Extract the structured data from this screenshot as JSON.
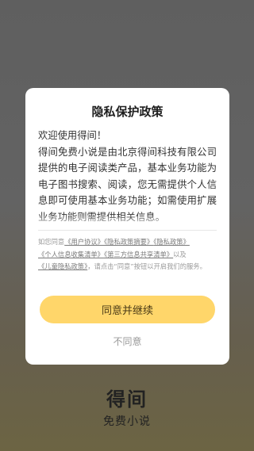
{
  "splash": {
    "app_name": "得间",
    "tagline": "免费小说"
  },
  "dialog": {
    "title": "隐私保护政策",
    "greeting": "欢迎使用得间！",
    "body": "得间免费小说是由北京得间科技有限公司提供的电子阅读类产品，基本业务功能为电子图书搜索、阅读，您无需提供个人信息即可使用基本业务功能；如需使用扩展业务功能则需提供相关信息。",
    "consent": {
      "prefix": "如您同意",
      "link_user_agreement": "《用户协议》",
      "link_privacy_summary": "《隐私政策摘要》",
      "link_privacy_policy": "《隐私政策》",
      "link_info_collection": "《个人信息收集清单》",
      "link_third_party": "《第三方信息共享清单》",
      "and_text": "以及",
      "link_children_privacy": "《儿童隐私政策》",
      "suffix": "，请点击“同意”按钮以开启我们的服务。"
    },
    "agree_label": "同意并继续",
    "disagree_label": "不同意"
  },
  "colors": {
    "accent_button": "#ffd66a",
    "dialog_bg": "#ffffff",
    "overlay": "#5f5f5f"
  }
}
